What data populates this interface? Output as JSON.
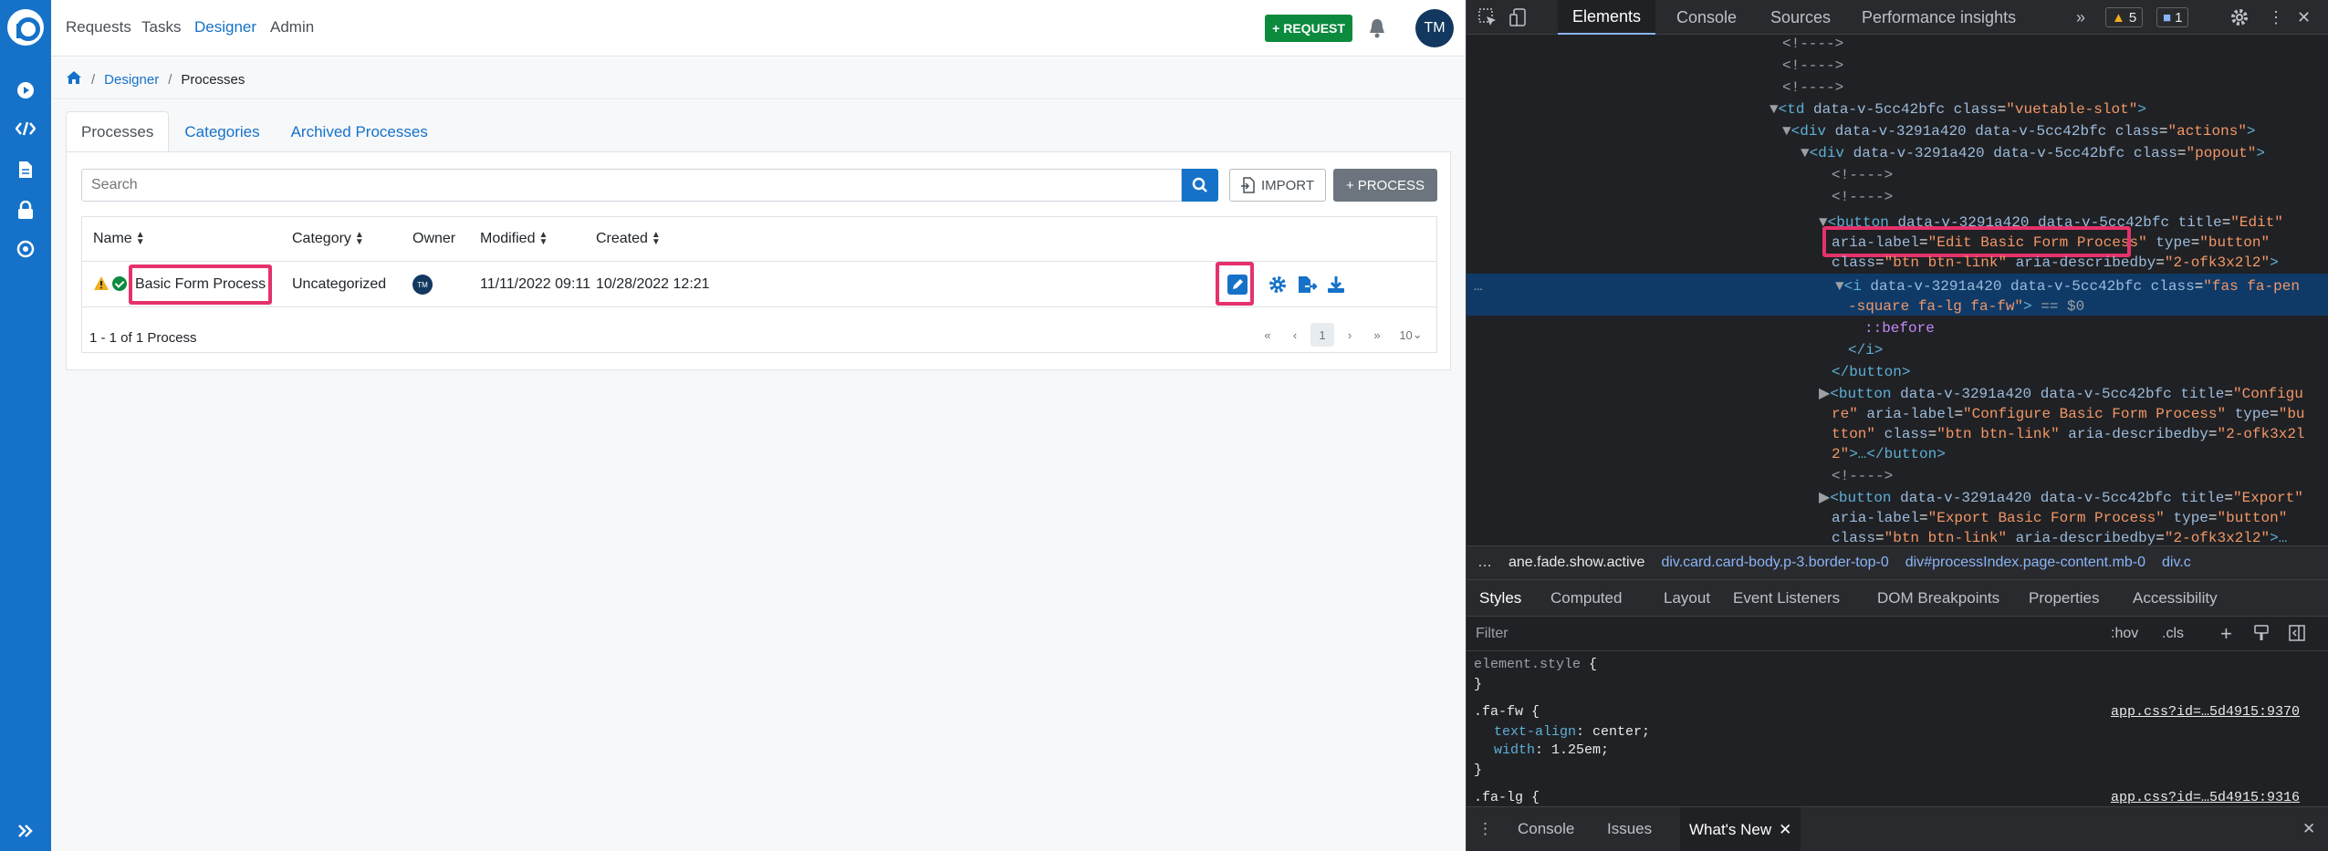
{
  "app": {
    "nav": [
      "Requests",
      "Tasks",
      "Designer",
      "Admin"
    ],
    "request_button": "REQUEST",
    "avatar_initials": "TM"
  },
  "breadcrumb": {
    "designer": "Designer",
    "current": "Processes"
  },
  "tabs": [
    "Processes",
    "Categories",
    "Archived Processes"
  ],
  "toolbar": {
    "search_placeholder": "Search",
    "import_label": "IMPORT",
    "process_label": "PROCESS"
  },
  "table": {
    "headers": [
      "Name",
      "Category",
      "Owner",
      "Modified",
      "Created"
    ],
    "row": {
      "name": "Basic Form Process",
      "category": "Uncategorized",
      "owner_initials": "TM",
      "modified": "11/11/2022 09:11",
      "created": "10/28/2022 12:21"
    },
    "footer": "1 - 1 of 1 Process",
    "pager": {
      "first": "«",
      "prev": "‹",
      "page": "1",
      "next": "›",
      "last": "»",
      "per_page": "10"
    }
  },
  "devtools": {
    "tabs": [
      "Elements",
      "Console",
      "Sources",
      "Performance insights"
    ],
    "warnings": "5",
    "messages": "1",
    "path": [
      "ane.fade.show.active",
      "div.card.card-body.p-3.border-top-0",
      "div#processIndex.page-content.mb-0",
      "div.c"
    ],
    "style_tabs": [
      "Styles",
      "Computed",
      "Layout",
      "Event Listeners",
      "DOM Breakpoints",
      "Properties",
      "Accessibility"
    ],
    "filter_placeholder": "Filter",
    "hov": ":hov",
    "cls": ".cls",
    "drawer_tabs": [
      "Console",
      "Issues",
      "What's New"
    ]
  }
}
